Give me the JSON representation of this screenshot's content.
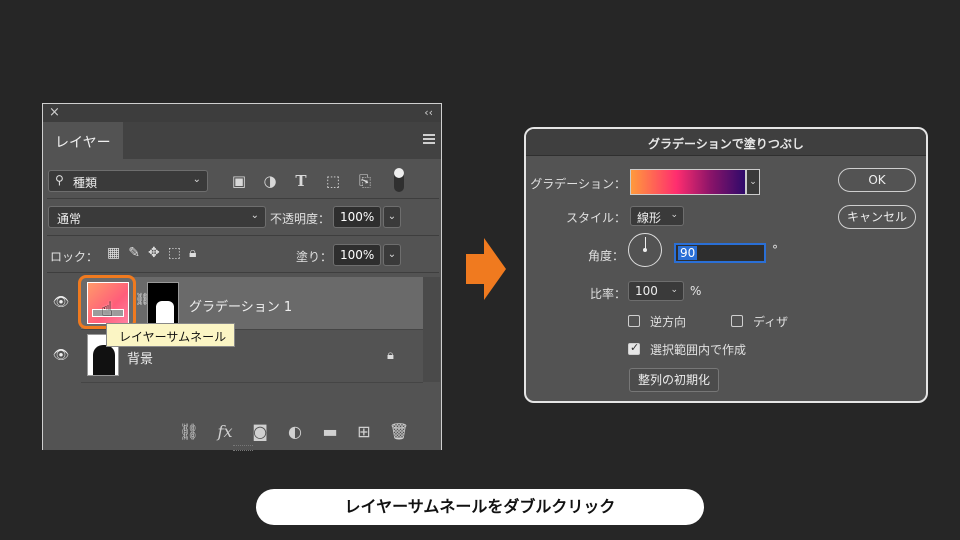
{
  "layers_panel": {
    "close_glyph": "×",
    "collapse_glyph": "‹‹",
    "tab_label": "レイヤー",
    "filter": {
      "label": "種類"
    },
    "blend_mode": "通常",
    "opacity_label": "不透明度：",
    "opacity_value": "100%",
    "lock_label": "ロック：",
    "fill_label": "塗り：",
    "fill_value": "100%",
    "layers": [
      {
        "name": "グラデーション 1",
        "selected": true
      },
      {
        "name": "背景",
        "locked": true
      }
    ],
    "tooltip": "レイヤーサムネール",
    "bottom_fx_label": "fx"
  },
  "dialog": {
    "title": "グラデーションで塗りつぶし",
    "gradient_label": "グラデーション：",
    "style_label": "スタイル：",
    "style_value": "線形",
    "angle_label": "角度：",
    "angle_value": "90",
    "angle_unit": "°",
    "scale_label": "比率：",
    "scale_value": "100",
    "scale_unit": "%",
    "reverse_label": "逆方向",
    "reverse_checked": false,
    "dither_label": "ディザ",
    "dither_checked": false,
    "align_label": "選択範囲内で作成",
    "align_checked": true,
    "reset_alignment_label": "整列の初期化",
    "ok_label": "OK",
    "cancel_label": "キャンセル"
  },
  "caption": "レイヤーサムネールをダブルクリック",
  "colors": {
    "accent_orange": "#f07a1f",
    "selection_blue": "#2a6fd6",
    "tooltip_bg": "#fbf5c4"
  },
  "icons": {
    "filter_icons": [
      "image-filter-icon",
      "adjustment-filter-icon",
      "type-filter-icon",
      "shape-filter-icon",
      "smart-object-filter-icon"
    ],
    "lock_icons": [
      "lock-transparent-icon",
      "lock-paint-icon",
      "lock-position-icon",
      "lock-artboard-icon",
      "lock-all-icon"
    ],
    "bottom_icons": [
      "link-icon",
      "fx-icon",
      "mask-icon",
      "adjustment-icon",
      "folder-icon",
      "new-layer-icon",
      "trash-icon"
    ]
  }
}
